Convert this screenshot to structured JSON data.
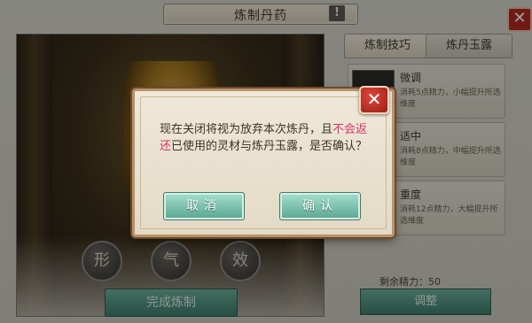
{
  "window": {
    "title": "炼制丹药",
    "help_label": "!",
    "close_label": "✕"
  },
  "tabs": [
    {
      "label": "炼制技巧",
      "active": true
    },
    {
      "label": "炼丹玉露",
      "active": false
    }
  ],
  "options": [
    {
      "name": "微调",
      "desc": "消耗5点精力，小幅提升所选维度"
    },
    {
      "name": "适中",
      "desc": "消耗8点精力，中幅提升所选维度"
    },
    {
      "name": "重度",
      "desc": "消耗12点精力，大幅提升所选维度"
    }
  ],
  "energy_text": "剩余精力：50",
  "adjust_label": "调整",
  "round_buttons": [
    "形",
    "气",
    "效"
  ],
  "finish_label": "完成炼制",
  "dialog": {
    "close_label": "✕",
    "msg_part1": "现在关闭将视为放弃本次炼丹，且",
    "msg_highlight": "不会返还",
    "msg_part2": "已使用的灵材与炼丹玉露，是否确认？",
    "cancel_label": "取消",
    "confirm_label": "确认"
  },
  "colors": {
    "highlight": "#d2366a",
    "button": "#58a68d",
    "close": "#b52a22"
  }
}
